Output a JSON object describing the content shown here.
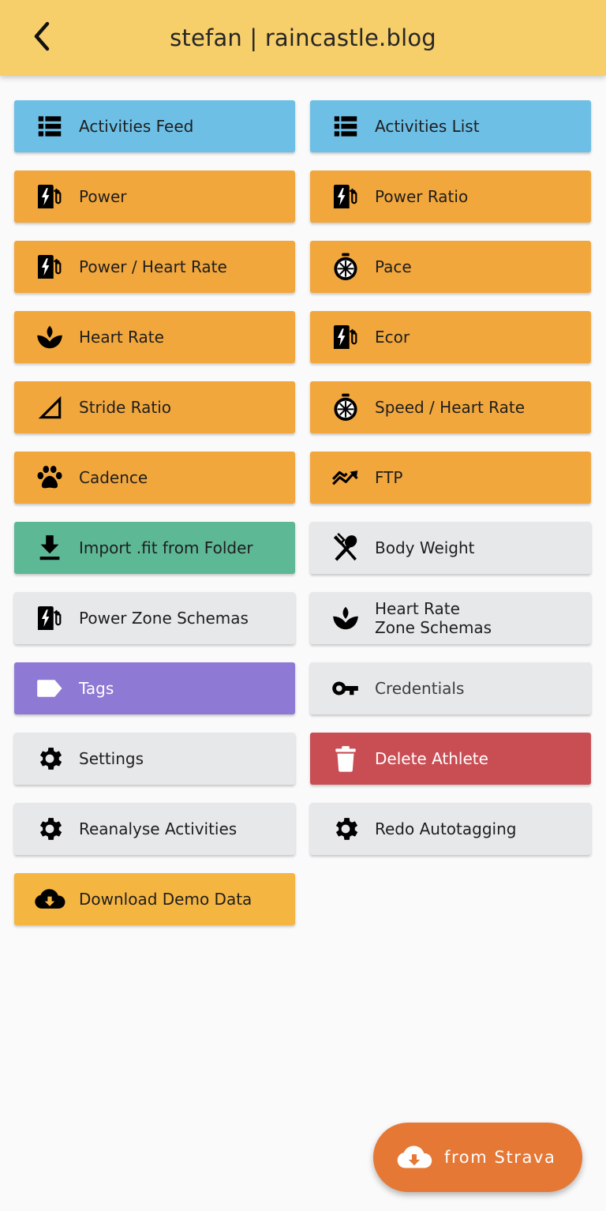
{
  "header": {
    "title": "stefan | raincastle.blog",
    "back_icon": "chevron-left-icon",
    "background": "#f6ce6a"
  },
  "colors": {
    "blue": "#6dbfe6",
    "orange": "#f2a73c",
    "green": "#5db896",
    "grey": "#e7e8ea",
    "purple": "#8e79d4",
    "red": "#c94e54",
    "yellow": "#f5b541",
    "fab": "#e67836"
  },
  "tiles": [
    {
      "label": "Activities Feed",
      "icon": "list-icon",
      "color": "blue"
    },
    {
      "label": "Activities List",
      "icon": "list-icon",
      "color": "blue"
    },
    {
      "label": "Power",
      "icon": "power-meter-icon",
      "color": "orange"
    },
    {
      "label": "Power Ratio",
      "icon": "power-meter-icon",
      "color": "orange"
    },
    {
      "label": "Power / Heart Rate",
      "icon": "power-meter-icon",
      "color": "orange"
    },
    {
      "label": "Pace",
      "icon": "stopwatch-icon",
      "color": "orange"
    },
    {
      "label": "Heart Rate",
      "icon": "lotus-icon",
      "color": "orange"
    },
    {
      "label": "Ecor",
      "icon": "power-meter-icon",
      "color": "orange"
    },
    {
      "label": "Stride Ratio",
      "icon": "triangle-icon",
      "color": "orange"
    },
    {
      "label": "Speed / Heart Rate",
      "icon": "stopwatch-icon",
      "color": "orange"
    },
    {
      "label": "Cadence",
      "icon": "paw-icon",
      "color": "orange"
    },
    {
      "label": "FTP",
      "icon": "trend-icon",
      "color": "orange"
    },
    {
      "label": "Import .fit from Folder",
      "icon": "download-icon",
      "color": "green"
    },
    {
      "label": "Body Weight",
      "icon": "fork-spoon-icon",
      "color": "grey"
    },
    {
      "label": "Power Zone Schemas",
      "icon": "power-meter-icon",
      "color": "grey"
    },
    {
      "label": "Heart Rate\nZone Schemas",
      "icon": "lotus-icon",
      "color": "grey"
    },
    {
      "label": "Tags",
      "icon": "tag-icon",
      "color": "purple"
    },
    {
      "label": "Credentials",
      "icon": "key-icon",
      "color": "grey"
    },
    {
      "label": "Settings",
      "icon": "gear-icon",
      "color": "grey"
    },
    {
      "label": "Delete Athlete",
      "icon": "trash-icon",
      "color": "red"
    },
    {
      "label": "Reanalyse Activities",
      "icon": "gear-icon",
      "color": "grey"
    },
    {
      "label": "Redo Autotagging",
      "icon": "gear-icon",
      "color": "grey"
    },
    {
      "label": "Download Demo Data",
      "icon": "cloud-download-icon",
      "color": "yellow"
    }
  ],
  "fab": {
    "label": "from Strava",
    "icon": "cloud-download-icon"
  }
}
